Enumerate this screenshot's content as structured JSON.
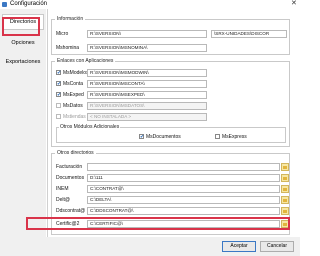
{
  "window": {
    "title": "Configuración"
  },
  "nav": {
    "items": [
      "Directorios",
      "Opciones",
      "Exportaciones"
    ]
  },
  "informacion": {
    "title": "Información",
    "micro_label": "Micro",
    "micro_value": "R:\\SVERSION\\",
    "micro_value2": "\\SRX-UNIDADES\\DISCOR",
    "mshomina_label": "Mshomina",
    "mshomina_value": "R:\\SVERSION\\MSNOMINA\\"
  },
  "enlaces": {
    "title": "Enlaces con Aplicaciones",
    "rows": [
      {
        "label": "MsModelos",
        "value": "R:\\SVERSION\\MSMODWIN\\",
        "checked": "✔",
        "disabled": false
      },
      {
        "label": "MsConta",
        "value": "R:\\SVERSION\\MSCONTA\\",
        "checked": "✔",
        "disabled": false
      },
      {
        "label": "MsExped",
        "value": "R:\\SVERSION\\MSEXPED\\",
        "checked": "✔",
        "disabled": false
      },
      {
        "label": "MsDatos",
        "value": "R:\\SVERSION\\MSDATOS\\",
        "checked": "",
        "disabled": true
      },
      {
        "label": "Mstiendas",
        "value": "< NO INSTALADA >",
        "checked": "",
        "disabled": true
      }
    ],
    "otros": {
      "title": "Otros Módulos Adicionales",
      "msdocumentos_label": "MsDocumentos",
      "msdocumentos_checked": "✔",
      "msexpress_label": "MsExpress",
      "msexpress_checked": ""
    }
  },
  "otros_directorios": {
    "title": "Otros directorios",
    "rows": [
      {
        "label": "Facturación",
        "value": ""
      },
      {
        "label": "Documentos",
        "value": "D:\\111"
      },
      {
        "label": "INEM",
        "value": "C:\\CONTRAT@\\"
      },
      {
        "label": "Delt@",
        "value": "C:\\DELTA\\"
      },
      {
        "label": "Ddscontrat@",
        "value": "C:\\DDSCONTRAT@\\"
      },
      {
        "label": "Certific@2",
        "value": "C:\\CERTIFIC@\\"
      }
    ]
  },
  "footer": {
    "accept_label": "Aceptar",
    "cancel_label": "Cancelar"
  },
  "colors": {
    "highlight": "#d9344a",
    "accent": "#3b78c4"
  },
  "icons": {
    "folder": "folder-icon",
    "check": "checkmark"
  }
}
